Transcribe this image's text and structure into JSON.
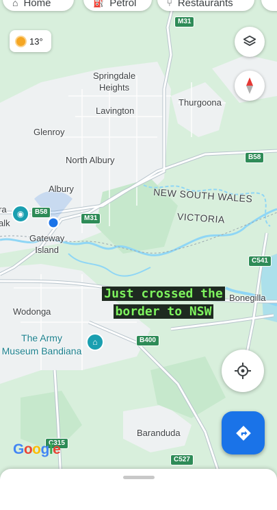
{
  "top_chips": [
    {
      "label": "Home",
      "icon": "home-icon"
    },
    {
      "label": "Petrol",
      "icon": "fuel-icon"
    },
    {
      "label": "Restaurants",
      "icon": "restaurant-icon"
    }
  ],
  "weather": {
    "temp": "13°",
    "icon": "sun-icon"
  },
  "places": {
    "springdale": "Springdale\nHeights",
    "thurgoona": "Thurgoona",
    "lavington": "Lavington",
    "glenroy": "Glenroy",
    "north_albury": "North Albury",
    "albury": "Albury",
    "gateway": "Gateway\nIsland",
    "wodonga": "Wodonga",
    "bonegilla": "Bonegilla",
    "baranduda": "Baranduda",
    "left_edge_1": "ra",
    "left_edge_2": "alk"
  },
  "states": {
    "nsw": "NEW SOUTH WALES",
    "vic": "VICTORIA"
  },
  "roads": {
    "m31_top": "M31",
    "m31_mid": "M31",
    "b58_left": "B58",
    "b58_right": "B58",
    "c541": "C541",
    "b400": "B400",
    "c315": "C315",
    "c527": "C527"
  },
  "poi": {
    "army_museum": "The Army\nMuseum Bandiana",
    "icon": "museum-icon"
  },
  "caption": {
    "line1": "Just crossed the",
    "line2": "border to NSW"
  },
  "attribution": {
    "logo": "Google"
  },
  "colors": {
    "land": "#d8efdc",
    "urban": "#eef1f2",
    "water": "#8fd6f5",
    "major_road": "#ffffff",
    "road_outline": "#b8c4cc",
    "location": "#1a73e8"
  }
}
